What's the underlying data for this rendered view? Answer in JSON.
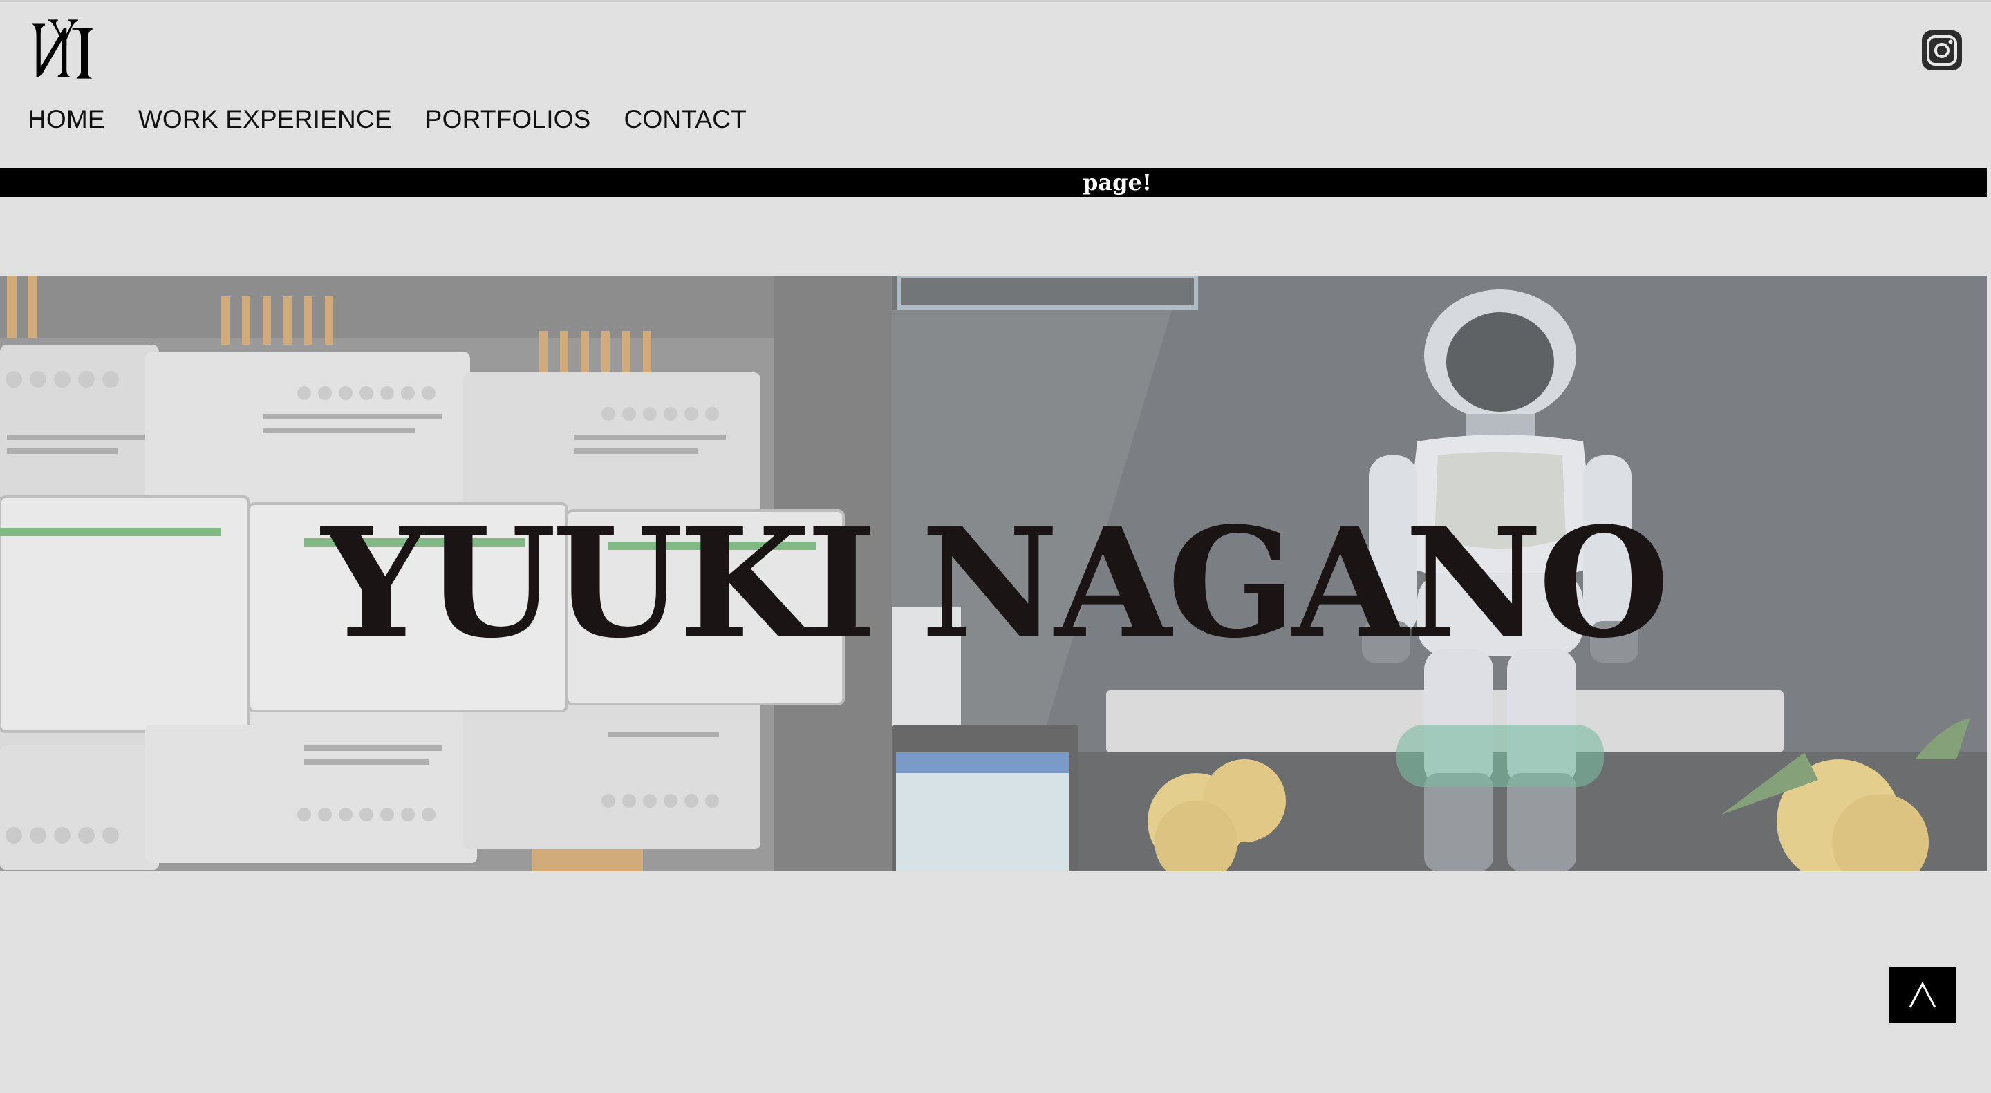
{
  "logo": {
    "icon": "ny-logo-icon"
  },
  "social": {
    "instagram_icon": "instagram-icon"
  },
  "nav": {
    "items": [
      {
        "label": "HOME"
      },
      {
        "label": "WORK EXPERIENCE"
      },
      {
        "label": "PORTFOLIOS"
      },
      {
        "label": "CONTACT"
      }
    ]
  },
  "banner": {
    "text": "page!"
  },
  "hero": {
    "title": "YUUKI NAGANO",
    "left_image": "building-controllers-image",
    "right_image": "humanoid-robot-image"
  },
  "back_to_top": {
    "icon": "caret-up-icon"
  },
  "colors": {
    "background": "#e1e1e1",
    "band": "#000000",
    "title": "#1a1414"
  }
}
